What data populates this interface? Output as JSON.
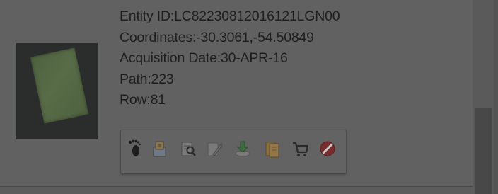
{
  "result": {
    "entity_id_label": "Entity ID:",
    "entity_id": "LC82230812016121LGN00",
    "coordinates_label": "Coordinates:",
    "coordinates": "-30.3061,-54.50849",
    "acquisition_date_label": "Acquisition Date:",
    "acquisition_date": "30-APR-16",
    "path_label": "Path:",
    "path": "223",
    "row_label": "Row:",
    "row": "81"
  },
  "toolbar": {
    "icons": [
      "footprint-icon",
      "browse-overlay-icon",
      "metadata-icon",
      "compare-icon",
      "download-icon",
      "bulk-download-icon",
      "cart-icon",
      "exclude-icon"
    ]
  },
  "colors": {
    "overlay": "#5c5c5c",
    "text": "#1f1f1f",
    "exclude_red": "#7a2c2c"
  }
}
